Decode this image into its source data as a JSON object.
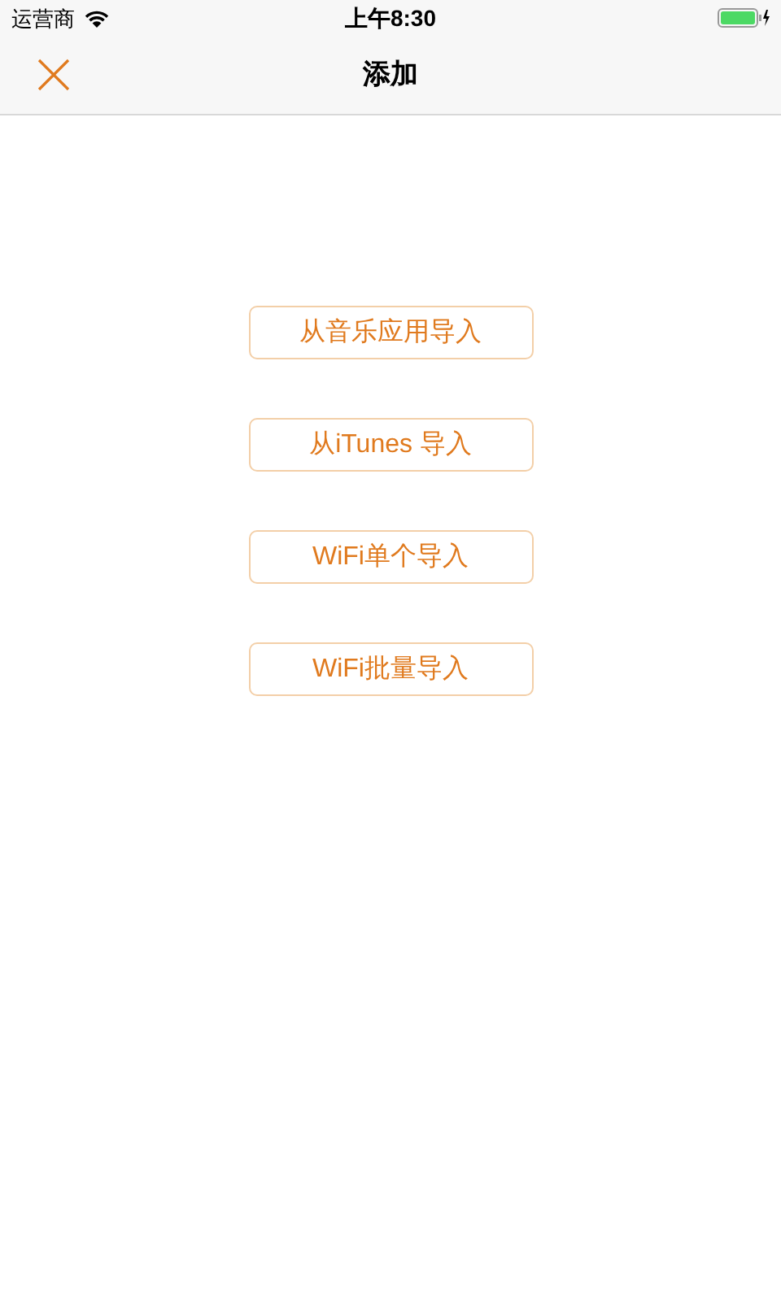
{
  "status_bar": {
    "carrier": "运营商",
    "time": "上午8:30"
  },
  "nav_bar": {
    "title": "添加"
  },
  "buttons": [
    {
      "label": "从音乐应用导入"
    },
    {
      "label": "从iTunes 导入"
    },
    {
      "label": "WiFi单个导入"
    },
    {
      "label": "WiFi批量导入"
    }
  ]
}
